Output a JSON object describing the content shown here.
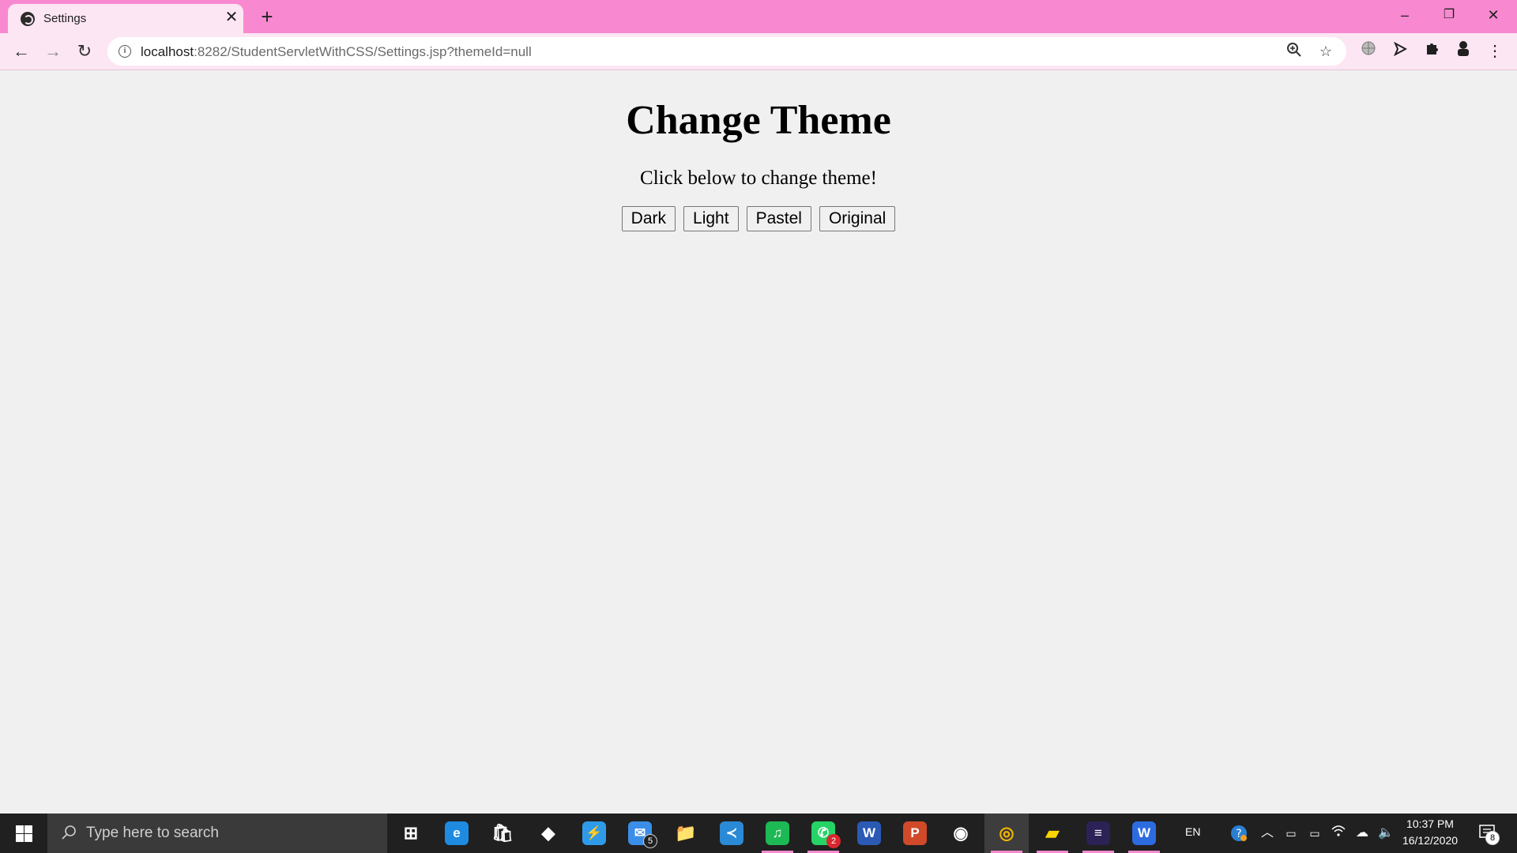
{
  "browser": {
    "tab_title": "Settings",
    "tab_close": "✕",
    "new_tab": "+",
    "url_host": "localhost",
    "url_rest": ":8282/StudentServletWithCSS/Settings.jsp?themeId=null",
    "window_controls": {
      "minimize": "–",
      "restore": "❐",
      "close": "✕"
    },
    "nav": {
      "back": "←",
      "forward": "→",
      "reload": "↻"
    },
    "icons": [
      "zoom-icon",
      "bookmark-star-icon",
      "extension-globe-icon",
      "send-icon",
      "puzzle-icon",
      "profile-icon",
      "more-menu-icon"
    ]
  },
  "page": {
    "heading": "Change Theme",
    "subtitle": "Click below to change theme!",
    "buttons": [
      "Dark",
      "Light",
      "Pastel",
      "Original"
    ]
  },
  "taskbar": {
    "search_placeholder": "Type here to search",
    "language": "EN",
    "time": "10:37 PM",
    "date": "16/12/2020",
    "notification_count": "8",
    "apps": [
      {
        "name": "task-view",
        "color": "#ffffff",
        "glyph": "⊞"
      },
      {
        "name": "edge",
        "color": "#1f8be0",
        "glyph": "e"
      },
      {
        "name": "microsoft-store",
        "color": "#ffffff",
        "glyph": "🛍"
      },
      {
        "name": "dropbox",
        "color": "#ffffff",
        "glyph": "◆"
      },
      {
        "name": "power-automate",
        "color": "#2f9be8",
        "glyph": "⚡"
      },
      {
        "name": "mail",
        "color": "#3b8ee8",
        "glyph": "✉",
        "badge": "5"
      },
      {
        "name": "file-explorer",
        "color": "#f5c542",
        "glyph": "📁"
      },
      {
        "name": "vs-code",
        "color": "#2a8ad6",
        "glyph": "≺"
      },
      {
        "name": "spotify",
        "color": "#1db954",
        "glyph": "♫"
      },
      {
        "name": "whatsapp",
        "color": "#25d366",
        "glyph": "✆",
        "badge": "2"
      },
      {
        "name": "word",
        "color": "#2b5ab5",
        "glyph": "W"
      },
      {
        "name": "powerpoint",
        "color": "#d04a2a",
        "glyph": "P"
      },
      {
        "name": "app-circle",
        "color": "#ffffff",
        "glyph": "◉"
      },
      {
        "name": "chrome",
        "color": "#f2b400",
        "glyph": "◎"
      },
      {
        "name": "sticky-notes",
        "color": "#f8d400",
        "glyph": "▰"
      },
      {
        "name": "eclipse",
        "color": "#2c2255",
        "glyph": "≡"
      },
      {
        "name": "wps-writer",
        "color": "#2d6be0",
        "glyph": "W"
      }
    ]
  }
}
